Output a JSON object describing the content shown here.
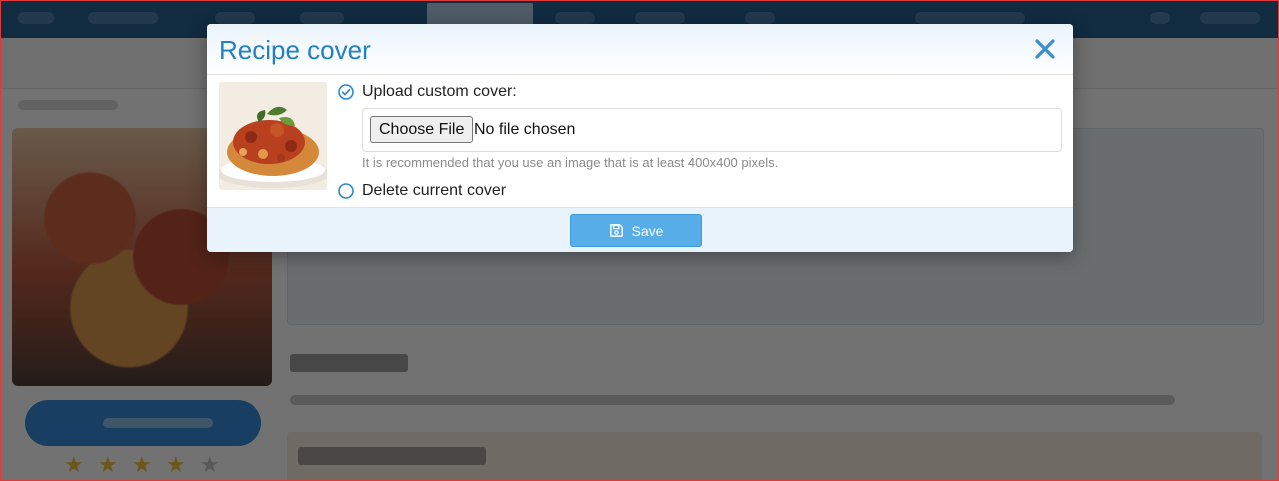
{
  "modal": {
    "title": "Recipe cover",
    "upload_label": "Upload custom cover:",
    "choose_file_label": "Choose File",
    "no_file_text": "No file chosen",
    "hint": "It is recommended that you use an image that is at least 400x400 pixels.",
    "delete_label": "Delete current cover",
    "save_label": "Save",
    "selected_option": "upload"
  },
  "background": {
    "rating_stars_filled": 4,
    "rating_stars_total": 5
  },
  "icons": {
    "close": "close-icon",
    "check": "check-circle-icon",
    "radio": "radio-empty-icon",
    "save": "floppy-disk-icon"
  },
  "colors": {
    "accent": "#2380c3",
    "save_button": "#57ade8",
    "footer": "#e8f3fc",
    "overlay": "#141414"
  }
}
